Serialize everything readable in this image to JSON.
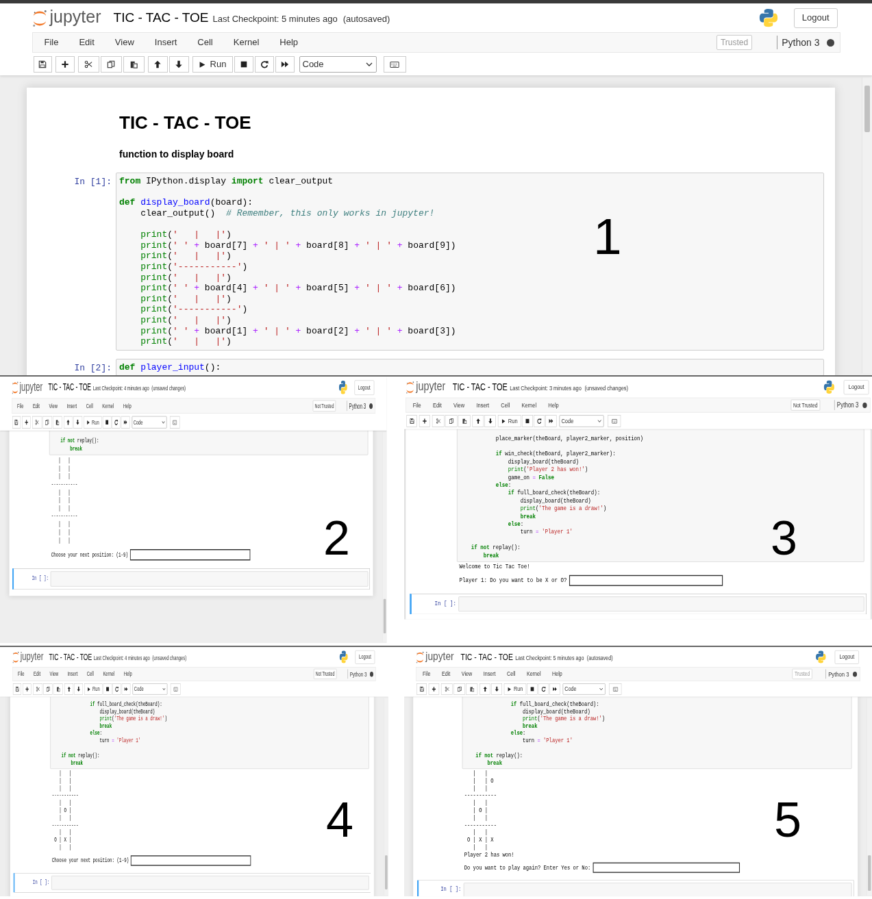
{
  "panels": [
    {
      "number": "1",
      "header": {
        "logo": "jupyter",
        "title": "TIC - TAC - TOE",
        "checkpoint": "Last Checkpoint: 5 minutes ago",
        "status": "(autosaved)",
        "logout": "Logout"
      },
      "menu": [
        "File",
        "Edit",
        "View",
        "Insert",
        "Cell",
        "Kernel",
        "Help"
      ],
      "trust": {
        "label": "Trusted",
        "trusted": true
      },
      "kernel": {
        "name": "Python 3",
        "busy": true
      },
      "toolbar": {
        "run": "Run",
        "cell_type": "Code"
      },
      "cells": [
        {
          "kind": "markdown",
          "blocks": [
            {
              "kind": "h1",
              "text": "TIC - TAC - TOE"
            },
            {
              "kind": "h4",
              "text": "function to display board"
            }
          ]
        },
        {
          "kind": "code",
          "prompt": "In [1]:",
          "selected": false,
          "lines": [
            {
              "tokens": [
                {
                  "kind": "kw",
                  "text": "from"
                },
                {
                  "kind": "p",
                  "text": " IPython.display "
                },
                {
                  "kind": "kw",
                  "text": "import"
                },
                {
                  "kind": "p",
                  "text": " clear_output"
                }
              ]
            },
            {
              "blank_before": true,
              "tokens": [
                {
                  "kind": "kw",
                  "text": "def "
                },
                {
                  "kind": "fn",
                  "text": "display_board"
                },
                {
                  "kind": "p",
                  "text": "(board):"
                }
              ]
            },
            {
              "tokens": [
                {
                  "kind": "p",
                  "text": "    clear_output()  "
                },
                {
                  "kind": "cm",
                  "text": "# Remember, this only works in jupyter!"
                }
              ]
            },
            {
              "blank_before": true,
              "tokens": [
                {
                  "kind": "bi",
                  "text": "    print"
                },
                {
                  "kind": "p",
                  "text": "("
                },
                {
                  "kind": "str",
                  "text": "'   |   |'"
                },
                {
                  "kind": "p",
                  "text": ")"
                }
              ]
            },
            {
              "tokens": [
                {
                  "kind": "bi",
                  "text": "    print"
                },
                {
                  "kind": "p",
                  "text": "("
                },
                {
                  "kind": "str",
                  "text": "' '"
                },
                {
                  "kind": "op",
                  "text": " +"
                },
                {
                  "kind": "p",
                  "text": " board[7] "
                },
                {
                  "kind": "op",
                  "text": "+"
                },
                {
                  "kind": "str",
                  "text": " ' | '"
                },
                {
                  "kind": "op",
                  "text": " +"
                },
                {
                  "kind": "p",
                  "text": " board[8] "
                },
                {
                  "kind": "op",
                  "text": "+"
                },
                {
                  "kind": "str",
                  "text": " ' | '"
                },
                {
                  "kind": "op",
                  "text": " +"
                },
                {
                  "kind": "p",
                  "text": " board[9])"
                }
              ]
            },
            {
              "tokens": [
                {
                  "kind": "bi",
                  "text": "    print"
                },
                {
                  "kind": "p",
                  "text": "("
                },
                {
                  "kind": "str",
                  "text": "'   |   |'"
                },
                {
                  "kind": "p",
                  "text": ")"
                }
              ]
            },
            {
              "tokens": [
                {
                  "kind": "bi",
                  "text": "    print"
                },
                {
                  "kind": "p",
                  "text": "("
                },
                {
                  "kind": "str",
                  "text": "'-----------'"
                },
                {
                  "kind": "p",
                  "text": ")"
                }
              ]
            },
            {
              "tokens": [
                {
                  "kind": "bi",
                  "text": "    print"
                },
                {
                  "kind": "p",
                  "text": "("
                },
                {
                  "kind": "str",
                  "text": "'   |   |'"
                },
                {
                  "kind": "p",
                  "text": ")"
                }
              ]
            },
            {
              "tokens": [
                {
                  "kind": "bi",
                  "text": "    print"
                },
                {
                  "kind": "p",
                  "text": "("
                },
                {
                  "kind": "str",
                  "text": "' '"
                },
                {
                  "kind": "op",
                  "text": " +"
                },
                {
                  "kind": "p",
                  "text": " board[4] "
                },
                {
                  "kind": "op",
                  "text": "+"
                },
                {
                  "kind": "str",
                  "text": " ' | '"
                },
                {
                  "kind": "op",
                  "text": " +"
                },
                {
                  "kind": "p",
                  "text": " board[5] "
                },
                {
                  "kind": "op",
                  "text": "+"
                },
                {
                  "kind": "str",
                  "text": " ' | '"
                },
                {
                  "kind": "op",
                  "text": " +"
                },
                {
                  "kind": "p",
                  "text": " board[6])"
                }
              ]
            },
            {
              "tokens": [
                {
                  "kind": "bi",
                  "text": "    print"
                },
                {
                  "kind": "p",
                  "text": "("
                },
                {
                  "kind": "str",
                  "text": "'   |   |'"
                },
                {
                  "kind": "p",
                  "text": ")"
                }
              ]
            },
            {
              "tokens": [
                {
                  "kind": "bi",
                  "text": "    print"
                },
                {
                  "kind": "p",
                  "text": "("
                },
                {
                  "kind": "str",
                  "text": "'-----------'"
                },
                {
                  "kind": "p",
                  "text": ")"
                }
              ]
            },
            {
              "tokens": [
                {
                  "kind": "bi",
                  "text": "    print"
                },
                {
                  "kind": "p",
                  "text": "("
                },
                {
                  "kind": "str",
                  "text": "'   |   |'"
                },
                {
                  "kind": "p",
                  "text": ")"
                }
              ]
            },
            {
              "tokens": [
                {
                  "kind": "bi",
                  "text": "    print"
                },
                {
                  "kind": "p",
                  "text": "("
                },
                {
                  "kind": "str",
                  "text": "' '"
                },
                {
                  "kind": "op",
                  "text": " +"
                },
                {
                  "kind": "p",
                  "text": " board[1] "
                },
                {
                  "kind": "op",
                  "text": "+"
                },
                {
                  "kind": "str",
                  "text": " ' | '"
                },
                {
                  "kind": "op",
                  "text": " +"
                },
                {
                  "kind": "p",
                  "text": " board[2] "
                },
                {
                  "kind": "op",
                  "text": "+"
                },
                {
                  "kind": "str",
                  "text": " ' | '"
                },
                {
                  "kind": "op",
                  "text": " +"
                },
                {
                  "kind": "p",
                  "text": " board[3])"
                }
              ]
            },
            {
              "tokens": [
                {
                  "kind": "bi",
                  "text": "    print"
                },
                {
                  "kind": "p",
                  "text": "("
                },
                {
                  "kind": "str",
                  "text": "'   |   |'"
                },
                {
                  "kind": "p",
                  "text": ")"
                }
              ]
            }
          ]
        },
        {
          "kind": "code",
          "prompt": "In [2]:",
          "selected": false,
          "lines": [
            {
              "tokens": [
                {
                  "kind": "kw",
                  "text": "def "
                },
                {
                  "kind": "fn",
                  "text": "player_input"
                },
                {
                  "kind": "p",
                  "text": "():"
                }
              ]
            }
          ]
        }
      ]
    },
    {
      "number": "2",
      "header": {
        "logo": "jupyter",
        "title": "TIC - TAC - TOE",
        "checkpoint": "Last Checkpoint: 4 minutes ago",
        "status": "(unsaved changes)",
        "logout": "Logout"
      },
      "menu": [
        "File",
        "Edit",
        "View",
        "Insert",
        "Cell",
        "Kernel",
        "Help"
      ],
      "trust": {
        "label": "Not Trusted",
        "trusted": false
      },
      "kernel": {
        "name": "Python 3",
        "busy": true
      },
      "toolbar": {
        "run": "Run",
        "cell_type": "Code"
      },
      "cells": [
        {
          "kind": "code",
          "selected": false,
          "lines": [
            {
              "tokens": [
                {
                  "kind": "kw",
                  "text": "    if"
                },
                {
                  "kind": "kw",
                  "text": " not"
                },
                {
                  "kind": "p",
                  "text": " replay():"
                }
              ]
            },
            {
              "tokens": [
                {
                  "kind": "kw",
                  "text": "        break"
                }
              ]
            }
          ],
          "outputs": [
            {
              "kind": "text",
              "lines": [
                "   |   |",
                "   |   |",
                "   |   |",
                "-----------",
                "   |   |",
                "   |   |",
                "   |   |",
                "-----------",
                "   |   |",
                "   |   |",
                "   |   |"
              ]
            },
            {
              "kind": "input",
              "label": "Choose your next position: (1-9)"
            }
          ]
        },
        {
          "kind": "code",
          "prompt": "In [ ]:",
          "selected": true
        }
      ]
    },
    {
      "number": "3",
      "header": {
        "logo": "jupyter",
        "title": "TIC - TAC - TOE",
        "checkpoint": "Last Checkpoint: 3 minutes ago",
        "status": "(unsaved changes)",
        "logout": "Logout"
      },
      "menu": [
        "File",
        "Edit",
        "View",
        "Insert",
        "Cell",
        "Kernel",
        "Help"
      ],
      "trust": {
        "label": "Not Trusted",
        "trusted": false
      },
      "kernel": {
        "name": "Python 3",
        "busy": true
      },
      "toolbar": {
        "run": "Run",
        "cell_type": "Code"
      },
      "cells": [
        {
          "kind": "code",
          "selected": false,
          "lines": [
            {
              "tokens": [
                {
                  "kind": "p",
                  "text": "            place_marker(theBoard, player2_marker, position)"
                }
              ]
            },
            {
              "blank_before": true,
              "tokens": [
                {
                  "kind": "kw",
                  "text": "            if"
                },
                {
                  "kind": "p",
                  "text": " win_check(theBoard, player2_marker):"
                }
              ]
            },
            {
              "tokens": [
                {
                  "kind": "p",
                  "text": "                display_board(theBoard)"
                }
              ]
            },
            {
              "tokens": [
                {
                  "kind": "bi",
                  "text": "                print"
                },
                {
                  "kind": "p",
                  "text": "("
                },
                {
                  "kind": "str",
                  "text": "'Player 2 has won!'"
                },
                {
                  "kind": "p",
                  "text": ")"
                }
              ]
            },
            {
              "tokens": [
                {
                  "kind": "p",
                  "text": "                game_on "
                },
                {
                  "kind": "op",
                  "text": "="
                },
                {
                  "kind": "kw",
                  "text": " False"
                }
              ]
            },
            {
              "tokens": [
                {
                  "kind": "kw",
                  "text": "            else"
                },
                {
                  "kind": "p",
                  "text": ":"
                }
              ]
            },
            {
              "tokens": [
                {
                  "kind": "kw",
                  "text": "                if"
                },
                {
                  "kind": "p",
                  "text": " full_board_check(theBoard):"
                }
              ]
            },
            {
              "tokens": [
                {
                  "kind": "p",
                  "text": "                    display_board(theBoard)"
                }
              ]
            },
            {
              "tokens": [
                {
                  "kind": "bi",
                  "text": "                    print"
                },
                {
                  "kind": "p",
                  "text": "("
                },
                {
                  "kind": "str",
                  "text": "'The game is a draw!'"
                },
                {
                  "kind": "p",
                  "text": ")"
                }
              ]
            },
            {
              "tokens": [
                {
                  "kind": "kw",
                  "text": "                    break"
                }
              ]
            },
            {
              "tokens": [
                {
                  "kind": "kw",
                  "text": "                else"
                },
                {
                  "kind": "p",
                  "text": ":"
                }
              ]
            },
            {
              "tokens": [
                {
                  "kind": "p",
                  "text": "                    turn "
                },
                {
                  "kind": "op",
                  "text": "="
                },
                {
                  "kind": "str",
                  "text": " 'Player 1'"
                }
              ]
            },
            {
              "blank_before": true,
              "tokens": [
                {
                  "kind": "kw",
                  "text": "    if"
                },
                {
                  "kind": "kw",
                  "text": " not"
                },
                {
                  "kind": "p",
                  "text": " replay():"
                }
              ]
            },
            {
              "tokens": [
                {
                  "kind": "kw",
                  "text": "        break"
                }
              ]
            }
          ],
          "outputs": [
            {
              "kind": "text",
              "lines": [
                "Welcome to Tic Tac Toe!"
              ]
            },
            {
              "kind": "input",
              "label": "Player 1: Do you want to be X or O?"
            }
          ]
        },
        {
          "kind": "code",
          "prompt": "In [ ]:",
          "selected": true
        }
      ]
    },
    {
      "number": "4",
      "header": {
        "logo": "jupyter",
        "title": "TIC - TAC - TOE",
        "checkpoint": "Last Checkpoint: 4 minutes ago",
        "status": "(unsaved changes)",
        "logout": "Logout"
      },
      "menu": [
        "File",
        "Edit",
        "View",
        "Insert",
        "Cell",
        "Kernel",
        "Help"
      ],
      "trust": {
        "label": "Not Trusted",
        "trusted": false
      },
      "kernel": {
        "name": "Python 3",
        "busy": true
      },
      "toolbar": {
        "run": "Run",
        "cell_type": "Code"
      },
      "cells": [
        {
          "kind": "code",
          "selected": false,
          "lines": [
            {
              "tokens": [
                {
                  "kind": "kw",
                  "text": "                if"
                },
                {
                  "kind": "p",
                  "text": " full_board_check(theBoard):"
                }
              ]
            },
            {
              "tokens": [
                {
                  "kind": "p",
                  "text": "                    display_board(theBoard)"
                }
              ]
            },
            {
              "tokens": [
                {
                  "kind": "bi",
                  "text": "                    print"
                },
                {
                  "kind": "p",
                  "text": "("
                },
                {
                  "kind": "str",
                  "text": "'The game is a draw!'"
                },
                {
                  "kind": "p",
                  "text": ")"
                }
              ]
            },
            {
              "tokens": [
                {
                  "kind": "kw",
                  "text": "                    break"
                }
              ]
            },
            {
              "tokens": [
                {
                  "kind": "kw",
                  "text": "                else"
                },
                {
                  "kind": "p",
                  "text": ":"
                }
              ]
            },
            {
              "tokens": [
                {
                  "kind": "p",
                  "text": "                    turn "
                },
                {
                  "kind": "op",
                  "text": "="
                },
                {
                  "kind": "str",
                  "text": " 'Player 1'"
                }
              ]
            },
            {
              "blank_before": true,
              "tokens": [
                {
                  "kind": "kw",
                  "text": "    if"
                },
                {
                  "kind": "kw",
                  "text": " not"
                },
                {
                  "kind": "p",
                  "text": " replay():"
                }
              ]
            },
            {
              "tokens": [
                {
                  "kind": "kw",
                  "text": "        break"
                }
              ]
            }
          ],
          "outputs": [
            {
              "kind": "text",
              "lines": [
                "   |   |",
                "   |   |",
                "   |   |",
                "-----------",
                "   |   |",
                "   | O |",
                "   |   |",
                "-----------",
                "   |   |",
                " O | X |",
                "   |   |"
              ]
            },
            {
              "kind": "input",
              "label": "Choose your next position: (1-9)"
            }
          ]
        },
        {
          "kind": "code",
          "prompt": "In [ ]:",
          "selected": true
        }
      ]
    },
    {
      "number": "5",
      "header": {
        "logo": "jupyter",
        "title": "TIC - TAC - TOE",
        "checkpoint": "Last Checkpoint: 5 minutes ago",
        "status": "(autosaved)",
        "logout": "Logout"
      },
      "menu": [
        "File",
        "Edit",
        "View",
        "Insert",
        "Cell",
        "Kernel",
        "Help"
      ],
      "trust": {
        "label": "Trusted",
        "trusted": true
      },
      "kernel": {
        "name": "Python 3",
        "busy": true
      },
      "toolbar": {
        "run": "Run",
        "cell_type": "Code"
      },
      "cells": [
        {
          "kind": "code",
          "selected": false,
          "lines": [
            {
              "tokens": [
                {
                  "kind": "kw",
                  "text": "                if"
                },
                {
                  "kind": "p",
                  "text": " full_board_check(theBoard):"
                }
              ]
            },
            {
              "tokens": [
                {
                  "kind": "p",
                  "text": "                    display_board(theBoard)"
                }
              ]
            },
            {
              "tokens": [
                {
                  "kind": "bi",
                  "text": "                    print"
                },
                {
                  "kind": "p",
                  "text": "("
                },
                {
                  "kind": "str",
                  "text": "'The game is a draw!'"
                },
                {
                  "kind": "p",
                  "text": ")"
                }
              ]
            },
            {
              "tokens": [
                {
                  "kind": "kw",
                  "text": "                    break"
                }
              ]
            },
            {
              "tokens": [
                {
                  "kind": "kw",
                  "text": "                else"
                },
                {
                  "kind": "p",
                  "text": ":"
                }
              ]
            },
            {
              "tokens": [
                {
                  "kind": "p",
                  "text": "                    turn "
                },
                {
                  "kind": "op",
                  "text": "="
                },
                {
                  "kind": "str",
                  "text": " 'Player 1'"
                }
              ]
            },
            {
              "blank_before": true,
              "tokens": [
                {
                  "kind": "kw",
                  "text": "    if"
                },
                {
                  "kind": "kw",
                  "text": " not"
                },
                {
                  "kind": "p",
                  "text": " replay():"
                }
              ]
            },
            {
              "tokens": [
                {
                  "kind": "kw",
                  "text": "        break"
                }
              ]
            }
          ],
          "outputs": [
            {
              "kind": "text",
              "lines": [
                "   |   |",
                "   |   | O",
                "   |   |",
                "-----------",
                "   |   |",
                "   | O |",
                "   |   |",
                "-----------",
                "   |   |",
                " O | X | X",
                "   |   |",
                "Player 2 has won!"
              ]
            },
            {
              "kind": "input",
              "label": "Do you want to play again? Enter Yes or No:"
            }
          ]
        },
        {
          "kind": "code",
          "prompt": "In [ ]:",
          "selected": true
        }
      ]
    }
  ]
}
